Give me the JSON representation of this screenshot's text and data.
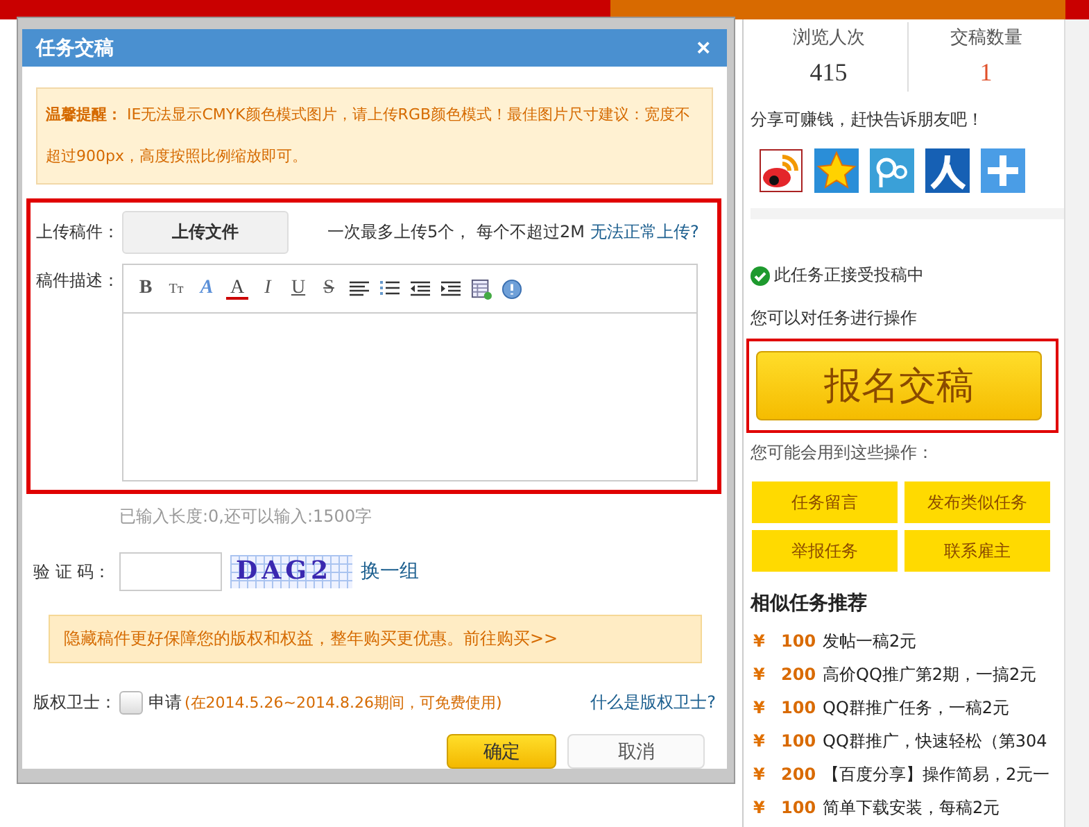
{
  "stats": [
    {
      "label": "浏览人次",
      "value": "415",
      "highlight": false
    },
    {
      "label": "交稿数量",
      "value": "1",
      "highlight": true
    }
  ],
  "share_text": "分享可赚钱，赶快告诉朋友吧！",
  "status": "此任务正接受投稿中",
  "operate_text": "您可以对任务进行操作",
  "main_button": "报名交稿",
  "more_text": "您可能会用到这些操作：",
  "actions": [
    "任务留言",
    "发布类似任务",
    "举报任务",
    "联系雇主"
  ],
  "similar": {
    "title": "相似任务推荐",
    "items": [
      {
        "currency": "¥",
        "amount": "100",
        "name": "发帖一稿2元"
      },
      {
        "currency": "¥",
        "amount": "200",
        "name": "高价QQ推广第2期，一搞2元"
      },
      {
        "currency": "¥",
        "amount": "100",
        "name": "QQ群推广任务，一稿2元"
      },
      {
        "currency": "¥",
        "amount": "100",
        "name": "QQ群推广，快速轻松（第304"
      },
      {
        "currency": "¥",
        "amount": "200",
        "name": "【百度分享】操作简易，2元一"
      },
      {
        "currency": "¥",
        "amount": "100",
        "name": "简单下载安装，每稿2元"
      }
    ]
  },
  "dialog": {
    "title": "任务交稿",
    "close": "×",
    "notice": "**温馨提醒：** IE无法显示CMYK颜色模式图片，请上传RGB颜色模式！最佳图片尺寸建议：宽度不超过900px，高度按照比例缩放即可。",
    "upload_label": "上传稿件：",
    "upload_button": "上传文件",
    "upload_hint": "一次最多上传5个， 每个不超过2M",
    "upload_help": "无法正常上传?",
    "desc_label": "稿件描述：",
    "toolbar": [
      {
        "kind": "bold",
        "label": "B"
      },
      {
        "kind": "size",
        "label": "Tт"
      },
      {
        "kind": "highlight",
        "label": "A"
      },
      {
        "kind": "color",
        "label": "A"
      },
      {
        "kind": "italic",
        "label": "I"
      },
      {
        "kind": "underline",
        "label": "U"
      },
      {
        "kind": "strike",
        "label": "S"
      },
      {
        "kind": "align"
      },
      {
        "kind": "list"
      },
      {
        "kind": "outdent"
      },
      {
        "kind": "indent"
      },
      {
        "kind": "table"
      },
      {
        "kind": "info"
      }
    ],
    "char_count": "已输入长度:0,还可以输入:1500字",
    "captcha_label": "验 证 码：",
    "captcha_text": "DAG2",
    "captcha_refresh": "换一组",
    "promo": "隐藏稿件更好保障您的版权和权益，整年购买更优惠。前往购买>>",
    "guard_label": "版权卫士：",
    "guard_checked": false,
    "guard_apply": "申请",
    "guard_period": "(在2014.5.26~2014.8.26期间，可免费使用)",
    "guard_help": "什么是版权卫士?",
    "ok": "确定",
    "cancel": "取消"
  }
}
